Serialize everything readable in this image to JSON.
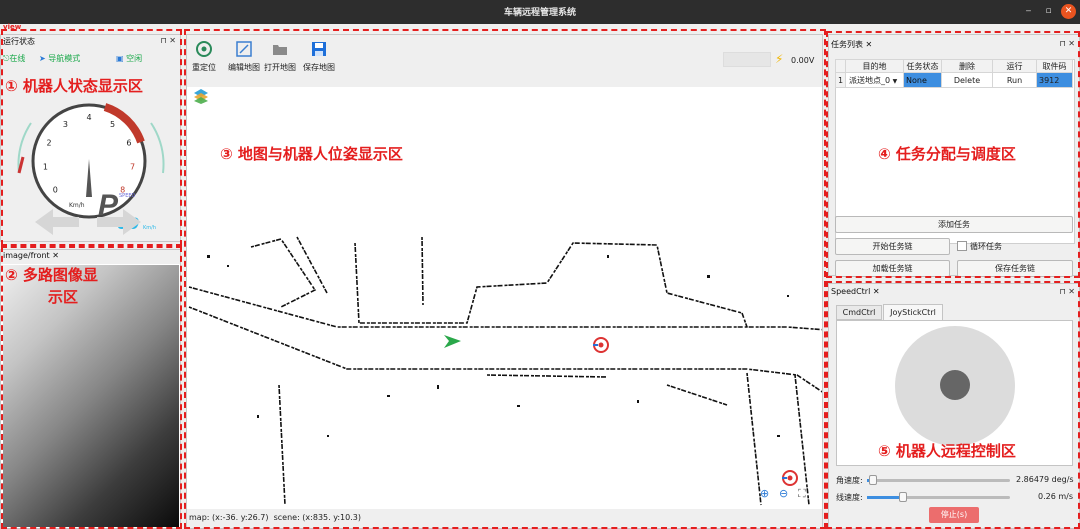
{
  "window": {
    "title": "车辆远程管理系统",
    "minimize": "‒",
    "maximize": "▫",
    "close": "✕"
  },
  "menu": {
    "view": "view"
  },
  "status_panel": {
    "title": "运行状态",
    "dock_pin": "⊓",
    "dock_close": "✕",
    "online": "在线",
    "nav_mode": "导航模式",
    "idle": "空闲",
    "gear": "P",
    "speed": "00",
    "speed_unit": "Km/h",
    "speed_tag": "SPEED",
    "gauge_unit": "Km/h",
    "ticks": [
      "0",
      "1",
      "2",
      "3",
      "4",
      "5",
      "6",
      "7",
      "8"
    ]
  },
  "image_panel": {
    "title": "image/front",
    "dock_close": "✕"
  },
  "map_panel": {
    "tools": [
      {
        "label": "重定位",
        "icon": "relocate-icon"
      },
      {
        "label": "编辑地图",
        "icon": "edit-map-icon"
      },
      {
        "label": "打开地图",
        "icon": "open-map-icon"
      },
      {
        "label": "保存地图",
        "icon": "save-map-icon"
      }
    ],
    "voltage": "0.00V",
    "status_bar": "map: (x:-36. y:26.7)  scene: (x:835. y:10.3)"
  },
  "task_panel": {
    "title": "任务列表",
    "dock_pin": "⊓",
    "dock_close": "✕",
    "columns": [
      "目的地",
      "任务状态",
      "删除",
      "运行",
      "取件码"
    ],
    "rows": [
      {
        "index": "1",
        "destination": "派送地点_0",
        "status": "None",
        "delete": "Delete",
        "run": "Run",
        "code": "3912"
      }
    ],
    "add_task": "添加任务",
    "start_chain": "开始任务链",
    "loop_task": "循环任务",
    "load_chain": "加载任务链",
    "save_chain": "保存任务链"
  },
  "speed_panel": {
    "title": "SpeedCtrl",
    "dock_pin": "⊓",
    "dock_close": "✕",
    "tabs": [
      "CmdCtrl",
      "JoyStickCtrl"
    ],
    "angular_label": "角速度:",
    "angular_value": "2.86479 deg/s",
    "angular_fraction": 0.03,
    "linear_label": "线速度:",
    "linear_value": "0.26 m/s",
    "linear_fraction": 0.25,
    "stop": "停止(s)"
  },
  "annotations": [
    "① 机器人状态显示区",
    "② 多路图像显",
    "示区",
    "③ 地图与机器人位姿显示区",
    "④ 任务分配与调度区",
    "⑤ 机器人远程控制区"
  ],
  "colors": {
    "annotation": "#e41e1e",
    "accent": "#3d8ee0",
    "stop_button": "#ec6d6d",
    "robot": "#2aa84a"
  }
}
